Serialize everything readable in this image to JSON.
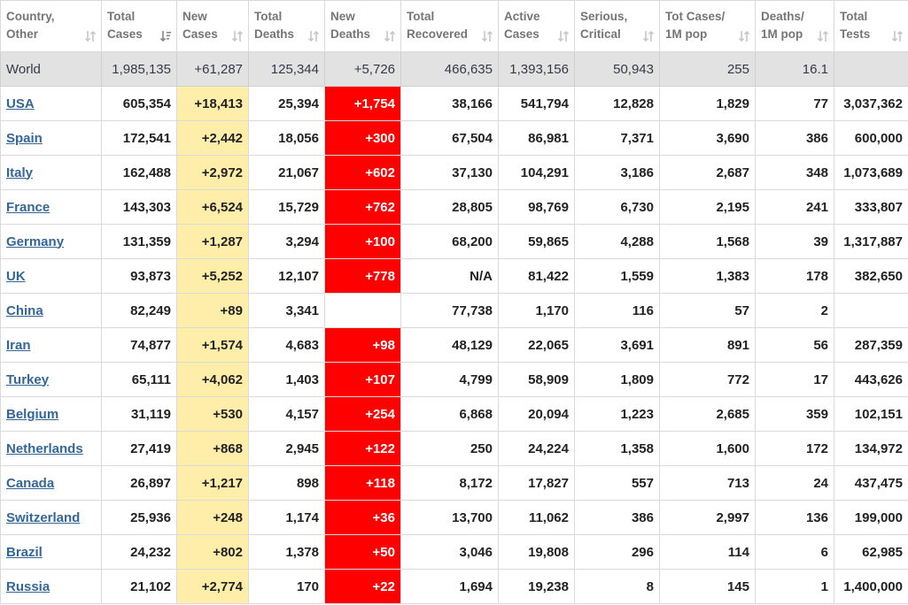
{
  "table": {
    "columns": [
      {
        "key": "country",
        "line1": "Country,",
        "line2": "Other",
        "sort_icon": "sort-arrows-icon"
      },
      {
        "key": "total_cases",
        "line1": "Total",
        "line2": "Cases",
        "sort_icon": "sort-descending-icon"
      },
      {
        "key": "new_cases",
        "line1": "New",
        "line2": "Cases",
        "sort_icon": "sort-arrows-icon"
      },
      {
        "key": "total_deaths",
        "line1": "Total",
        "line2": "Deaths",
        "sort_icon": "sort-arrows-icon"
      },
      {
        "key": "new_deaths",
        "line1": "New",
        "line2": "Deaths",
        "sort_icon": "sort-arrows-icon"
      },
      {
        "key": "total_recovered",
        "line1": "Total",
        "line2": "Recovered",
        "sort_icon": "sort-arrows-icon"
      },
      {
        "key": "active_cases",
        "line1": "Active",
        "line2": "Cases",
        "sort_icon": "sort-arrows-icon"
      },
      {
        "key": "serious_critical",
        "line1": "Serious,",
        "line2": "Critical",
        "sort_icon": "sort-arrows-icon"
      },
      {
        "key": "tot_cases_per_1m",
        "line1": "Tot Cases/",
        "line2": "1M pop",
        "sort_icon": "sort-arrows-icon"
      },
      {
        "key": "deaths_per_1m",
        "line1": "Deaths/",
        "line2": "1M pop",
        "sort_icon": "sort-arrows-icon"
      },
      {
        "key": "total_tests",
        "line1": "Total",
        "line2": "Tests",
        "sort_icon": "sort-arrows-icon"
      }
    ],
    "world": [
      "World",
      "1,985,135",
      "+61,287",
      "125,344",
      "+5,726",
      "466,635",
      "1,393,156",
      "50,943",
      "255",
      "16.1",
      ""
    ],
    "rows": [
      [
        "USA",
        "605,354",
        "+18,413",
        "25,394",
        "+1,754",
        "38,166",
        "541,794",
        "12,828",
        "1,829",
        "77",
        "3,037,362"
      ],
      [
        "Spain",
        "172,541",
        "+2,442",
        "18,056",
        "+300",
        "67,504",
        "86,981",
        "7,371",
        "3,690",
        "386",
        "600,000"
      ],
      [
        "Italy",
        "162,488",
        "+2,972",
        "21,067",
        "+602",
        "37,130",
        "104,291",
        "3,186",
        "2,687",
        "348",
        "1,073,689"
      ],
      [
        "France",
        "143,303",
        "+6,524",
        "15,729",
        "+762",
        "28,805",
        "98,769",
        "6,730",
        "2,195",
        "241",
        "333,807"
      ],
      [
        "Germany",
        "131,359",
        "+1,287",
        "3,294",
        "+100",
        "68,200",
        "59,865",
        "4,288",
        "1,568",
        "39",
        "1,317,887"
      ],
      [
        "UK",
        "93,873",
        "+5,252",
        "12,107",
        "+778",
        "N/A",
        "81,422",
        "1,559",
        "1,383",
        "178",
        "382,650"
      ],
      [
        "China",
        "82,249",
        "+89",
        "3,341",
        "",
        "77,738",
        "1,170",
        "116",
        "57",
        "2",
        ""
      ],
      [
        "Iran",
        "74,877",
        "+1,574",
        "4,683",
        "+98",
        "48,129",
        "22,065",
        "3,691",
        "891",
        "56",
        "287,359"
      ],
      [
        "Turkey",
        "65,111",
        "+4,062",
        "1,403",
        "+107",
        "4,799",
        "58,909",
        "1,809",
        "772",
        "17",
        "443,626"
      ],
      [
        "Belgium",
        "31,119",
        "+530",
        "4,157",
        "+254",
        "6,868",
        "20,094",
        "1,223",
        "2,685",
        "359",
        "102,151"
      ],
      [
        "Netherlands",
        "27,419",
        "+868",
        "2,945",
        "+122",
        "250",
        "24,224",
        "1,358",
        "1,600",
        "172",
        "134,972"
      ],
      [
        "Canada",
        "26,897",
        "+1,217",
        "898",
        "+118",
        "8,172",
        "17,827",
        "557",
        "713",
        "24",
        "437,475"
      ],
      [
        "Switzerland",
        "25,936",
        "+248",
        "1,174",
        "+36",
        "13,700",
        "11,062",
        "386",
        "2,997",
        "136",
        "199,000"
      ],
      [
        "Brazil",
        "24,232",
        "+802",
        "1,378",
        "+50",
        "3,046",
        "19,808",
        "296",
        "114",
        "6",
        "62,985"
      ],
      [
        "Russia",
        "21,102",
        "+2,774",
        "170",
        "+22",
        "1,694",
        "19,238",
        "8",
        "145",
        "1",
        "1,400,000"
      ]
    ],
    "colors": {
      "header_text": "#757575",
      "link": "#336699",
      "new_cases_bg": "#ffeeaa",
      "new_deaths_bg": "#ff0000",
      "world_bg": "#e2e2e2"
    }
  }
}
